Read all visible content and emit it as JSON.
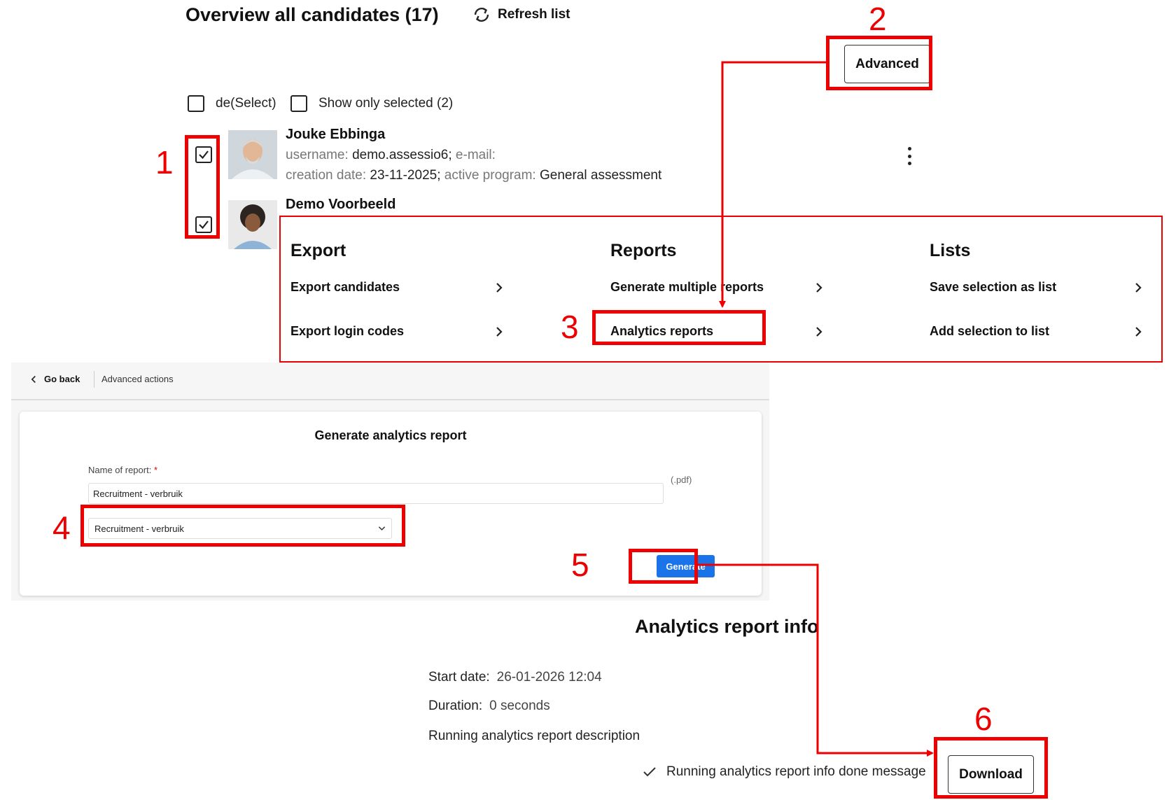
{
  "header": {
    "title": "Overview all candidates (17)",
    "refresh_label": "Refresh list",
    "advanced_label": "Advanced"
  },
  "selection": {
    "deselect_label": "de(Select)",
    "show_selected_label": "Show only selected (2)"
  },
  "candidates": [
    {
      "name": "Jouke Ebbinga",
      "username_key": "username:",
      "username_value": "demo.assessio6;",
      "email_key": "e-mail:",
      "creation_key": "creation date:",
      "creation_value": "23-11-2025;",
      "program_key": "active program:",
      "program_value": "General assessment",
      "checked": true
    },
    {
      "name": "Demo Voorbeeld",
      "checked": true
    }
  ],
  "menu": {
    "columns": [
      {
        "title": "Export",
        "items": [
          "Export candidates",
          "Export login codes"
        ]
      },
      {
        "title": "Reports",
        "items": [
          "Generate multiple reports",
          "Analytics reports"
        ]
      },
      {
        "title": "Lists",
        "items": [
          "Save selection as list",
          "Add selection to list"
        ]
      }
    ]
  },
  "form": {
    "go_back": "Go back",
    "breadcrumb": "Advanced actions",
    "title": "Generate analytics report",
    "name_label": "Name of report:",
    "required_mark": "*",
    "name_value": "Recruitment - verbruik",
    "ext": "(.pdf)",
    "select_value": "Recruitment - verbruik",
    "generate_label": "Generate"
  },
  "info": {
    "title": "Analytics report info",
    "start_label": "Start date:",
    "start_value": "26-01-2026 12:04",
    "duration_label": "Duration:",
    "duration_value": "0 seconds",
    "description": "Running analytics report description",
    "done_message": "Running analytics report info done message",
    "download_label": "Download"
  },
  "annotations": {
    "step_numbers": [
      "1",
      "2",
      "3",
      "4",
      "5",
      "6"
    ],
    "color": "#e00000"
  },
  "colors": {
    "accent": "#1a73e8",
    "annotation": "#e00000"
  }
}
